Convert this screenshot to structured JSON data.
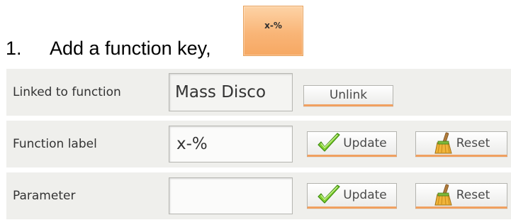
{
  "instruction": {
    "number": "1.",
    "text": "Add a function key,"
  },
  "function_key": {
    "label": "x-%",
    "color": "#f9b577"
  },
  "rows": {
    "linked": {
      "label": "Linked to function",
      "value": "Mass Disco",
      "unlink_label": "Unlink"
    },
    "function_label": {
      "label": "Function label",
      "value": "x-%",
      "update_label": "Update",
      "reset_label": "Reset"
    },
    "parameter": {
      "label": "Parameter",
      "value": "",
      "update_label": "Update",
      "reset_label": "Reset"
    }
  },
  "icons": {
    "update": "check-icon",
    "reset": "broom-icon"
  }
}
